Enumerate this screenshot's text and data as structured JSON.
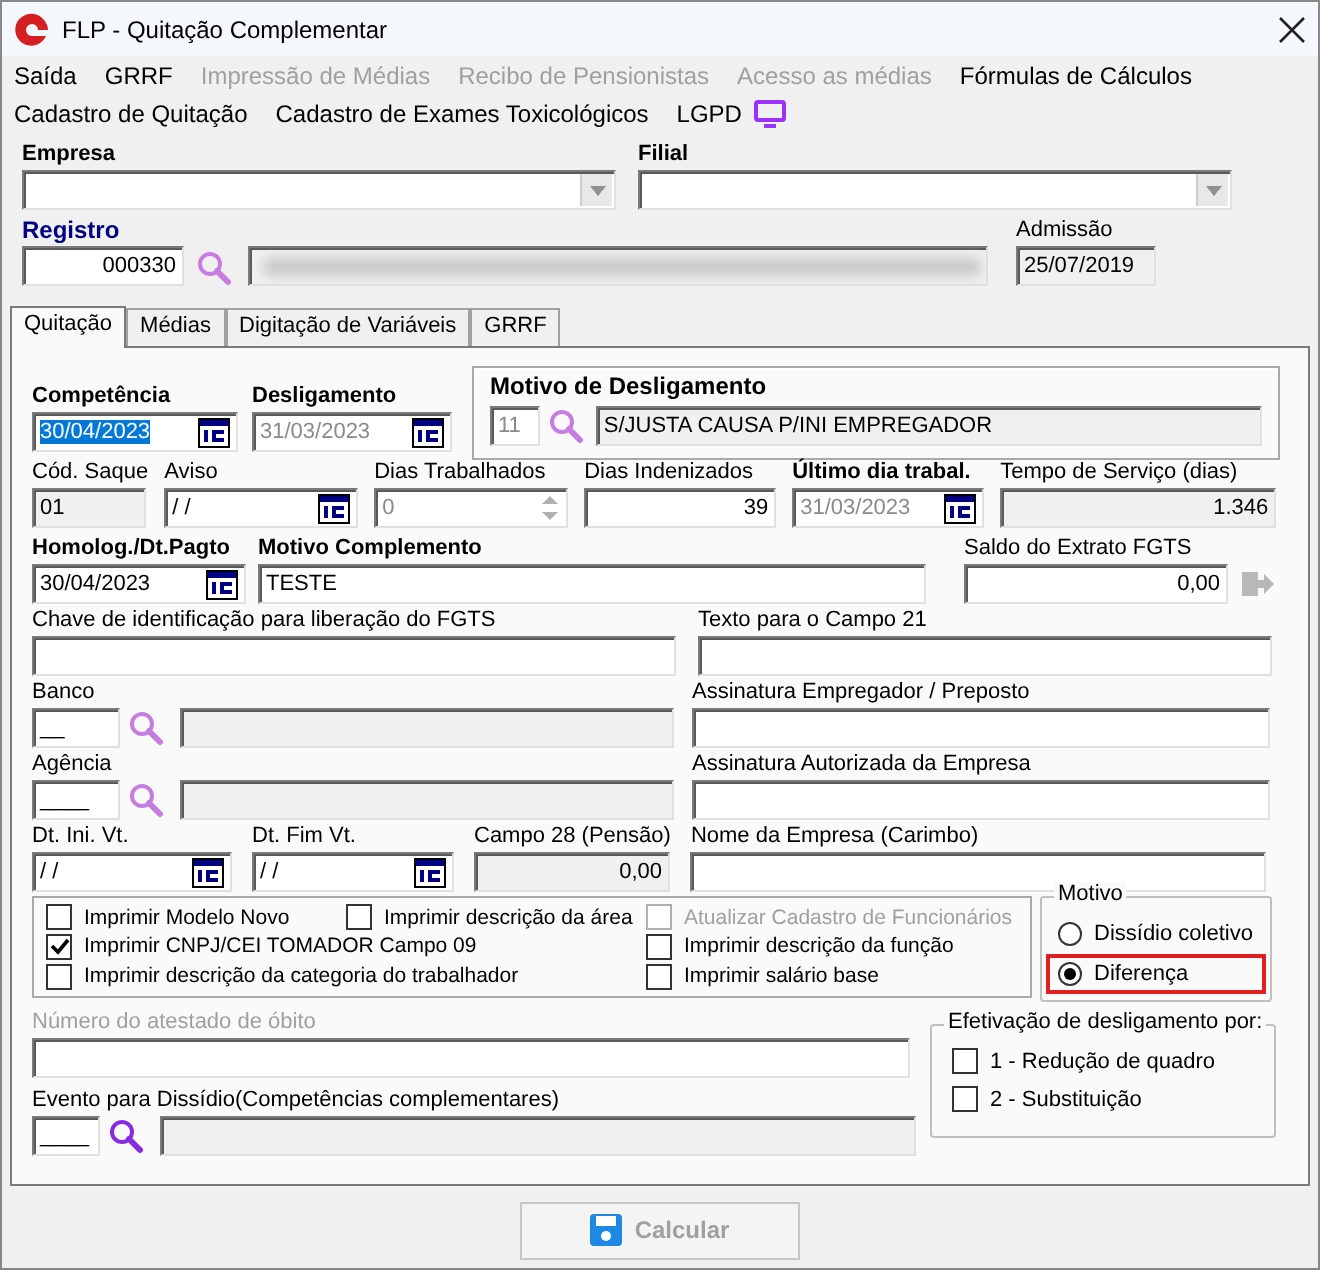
{
  "window": {
    "title": "FLP - Quitação Complementar"
  },
  "menu": [
    [
      {
        "label": "Saída",
        "disabled": false
      },
      {
        "label": "GRRF",
        "disabled": false
      },
      {
        "label": "Impressão de Médias",
        "disabled": true
      },
      {
        "label": "Recibo de Pensionistas",
        "disabled": true
      },
      {
        "label": "Acesso as médias",
        "disabled": true
      },
      {
        "label": "Fórmulas de Cálculos",
        "disabled": false
      }
    ],
    [
      {
        "label": "Cadastro de Quitação",
        "disabled": false
      },
      {
        "label": "Cadastro de Exames Toxicológicos",
        "disabled": false
      },
      {
        "label": "LGPD",
        "disabled": false,
        "kind": "with_icon"
      }
    ]
  ],
  "header": {
    "empresa": {
      "label": "Empresa",
      "bold": true,
      "kind": "combo"
    },
    "filial": {
      "label": "Filial",
      "bold": true,
      "kind": "combo"
    },
    "registro": {
      "label": "Registro",
      "bold": true,
      "kind": "text",
      "value": "000330"
    },
    "admissao": {
      "label": "Admissão",
      "bold": false,
      "kind": "text",
      "value": "25/07/2019",
      "readonly": true
    }
  },
  "tabs": [
    {
      "label": "Quitação",
      "selected": true
    },
    {
      "label": "Médias",
      "selected": false
    },
    {
      "label": "Digitação de Variáveis",
      "selected": false
    },
    {
      "label": "GRRF",
      "selected": false
    }
  ],
  "form": {
    "competencia": {
      "label": "Competência",
      "bold": true,
      "kind": "date",
      "value": "30/04/2023",
      "text_selected": true
    },
    "desligamento": {
      "label": "Desligamento",
      "bold": true,
      "kind": "date",
      "value": "31/03/2023",
      "disabled": true
    },
    "motivo_desligamento": {
      "title": "Motivo de Desligamento",
      "code": "11",
      "description": "S/JUSTA CAUSA P/INI EMPREGADOR"
    },
    "cod_saque": {
      "label": "Cód. Saque",
      "bold": false,
      "kind": "text",
      "value": "01",
      "readonly": true
    },
    "aviso": {
      "label": "Aviso",
      "bold": false,
      "kind": "date",
      "value": " / /"
    },
    "dias_trabalhados": {
      "label": "Dias Trabalhados",
      "bold": false,
      "kind": "spin",
      "value": "0",
      "disabled": true
    },
    "dias_indenizados": {
      "label": "Dias Indenizados",
      "bold": false,
      "kind": "text",
      "value": "39"
    },
    "ultimo_dia_trabalhado": {
      "label": "Último dia trabal.",
      "bold": true,
      "kind": "date",
      "value": "31/03/2023",
      "disabled": true
    },
    "tempo_servico": {
      "label": "Tempo de Serviço (dias)",
      "bold": false,
      "kind": "text",
      "value": "1.346",
      "readonly": true
    },
    "homologacao": {
      "label": "Homolog./Dt.Pagto",
      "bold": true,
      "kind": "date",
      "value": "30/04/2023"
    },
    "motivo_complemento": {
      "label": "Motivo Complemento",
      "bold": true,
      "kind": "text",
      "value": "TESTE"
    },
    "saldo_fgts": {
      "label": "Saldo do Extrato FGTS",
      "bold": false,
      "kind": "text",
      "value": "0,00"
    },
    "chave_fgts": {
      "label": "Chave de identificação para liberação do FGTS",
      "bold": false,
      "kind": "text"
    },
    "texto_campo_21": {
      "label": "Texto para o Campo 21",
      "bold": false,
      "kind": "text"
    },
    "banco": {
      "label": "Banco",
      "code": "__"
    },
    "assinatura_empregador": {
      "label": "Assinatura Empregador / Preposto",
      "bold": false,
      "kind": "text"
    },
    "agencia": {
      "label": "Agência",
      "code": "____"
    },
    "assinatura_autorizada": {
      "label": "Assinatura Autorizada da Empresa",
      "bold": false,
      "kind": "text"
    },
    "dt_ini_vt": {
      "label": "Dt. Ini. Vt.",
      "bold": false,
      "kind": "date",
      "value": " / /"
    },
    "dt_fim_vt": {
      "label": "Dt. Fim Vt.",
      "bold": false,
      "kind": "date",
      "value": " / /"
    },
    "campo_28": {
      "label": "Campo 28 (Pensão)",
      "bold": false,
      "kind": "text",
      "value": "0,00",
      "readonly": true
    },
    "nome_empresa": {
      "label": "Nome da Empresa (Carimbo)",
      "bold": false,
      "kind": "text"
    },
    "numero_atestado": {
      "label": "Número do atestado de óbito",
      "bold": false,
      "kind": "text",
      "label_disabled": true
    },
    "evento_dissidio": {
      "label": "Evento para Dissídio(Competências complementares)",
      "code": "____"
    }
  },
  "print_options": [
    [
      {
        "label": "Imprimir Modelo Novo",
        "checked": false,
        "disabled": false
      },
      {
        "label": "Imprimir CNPJ/CEI TOMADOR Campo 09",
        "checked": true,
        "disabled": false
      },
      {
        "label": "Imprimir descrição da categoria do trabalhador",
        "checked": false,
        "disabled": false
      }
    ],
    [
      {
        "label": "Imprimir descrição da área",
        "checked": false,
        "disabled": false
      }
    ],
    [
      {
        "label": "Atualizar Cadastro de Funcionários",
        "checked": false,
        "disabled": true
      },
      {
        "label": "Imprimir descrição da função",
        "checked": false,
        "disabled": false
      },
      {
        "label": "Imprimir salário base",
        "checked": false,
        "disabled": false
      }
    ]
  ],
  "motivo": {
    "title": "Motivo",
    "options": [
      {
        "label": "Dissídio coletivo",
        "selected": false,
        "highlighted": false
      },
      {
        "label": "Diferença",
        "selected": true,
        "highlighted": true
      }
    ]
  },
  "efetivacao": {
    "title": "Efetivação de desligamento por:",
    "options": [
      {
        "label": "1 - Redução de quadro",
        "checked": false
      },
      {
        "label": "2 - Substituição",
        "checked": false
      }
    ]
  },
  "button": {
    "label": "Calcular",
    "disabled": true
  }
}
